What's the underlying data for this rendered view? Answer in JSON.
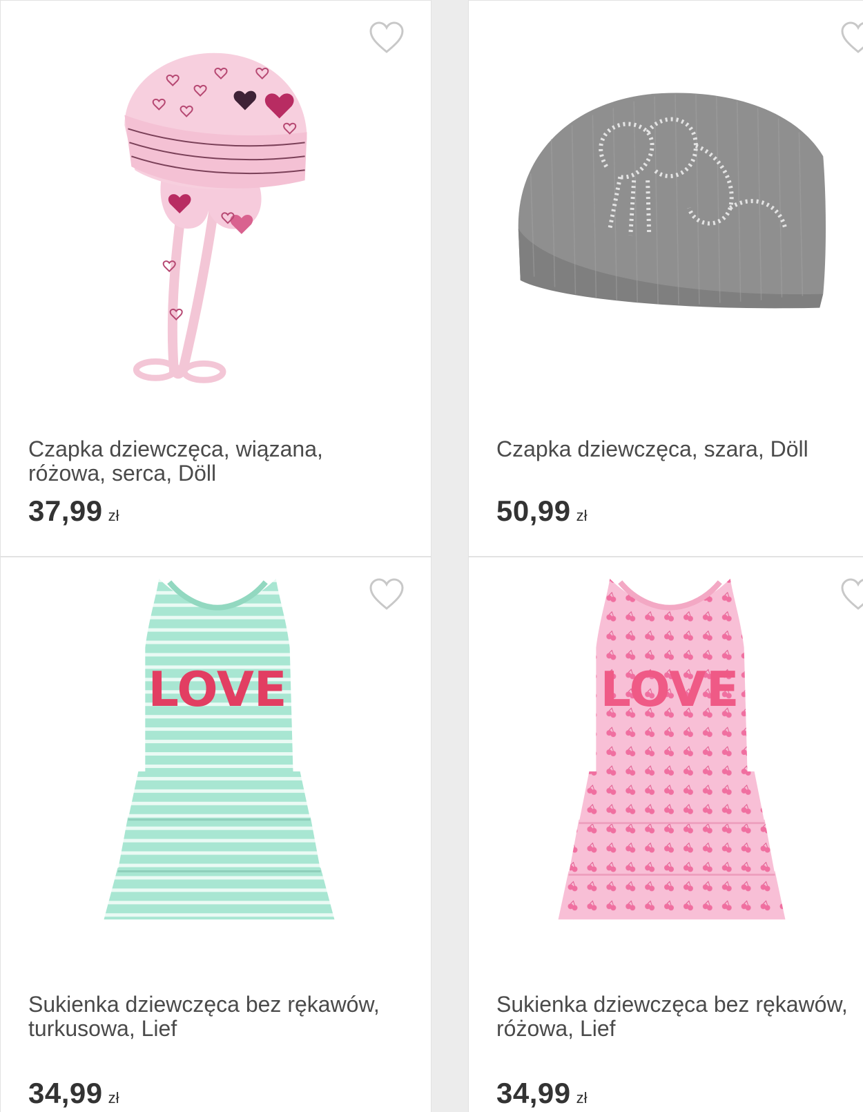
{
  "products": [
    {
      "title": "Czapka dziewczęca, wiązana, różowa, serca, Döll",
      "price": "37,99",
      "currency": "zł",
      "wishlist_icon": "heart-outline-icon",
      "image": "pink hat with hearts and ties"
    },
    {
      "title": "Czapka dziewczęca, szara, Döll",
      "price": "50,99",
      "currency": "zł",
      "wishlist_icon": "heart-outline-icon",
      "image": "grey knitted beanie with rhinestones"
    },
    {
      "title": "Sukienka dziewczęca bez rękawów, turkusowa, Lief",
      "price": "34,99",
      "currency": "zł",
      "wishlist_icon": "heart-outline-icon",
      "image": "turquoise striped tiered dress with LOVE print"
    },
    {
      "title": "Sukienka dziewczęca bez rękawów, różowa, Lief",
      "price": "34,99",
      "currency": "zł",
      "wishlist_icon": "heart-outline-icon",
      "image": "pink cherry print tiered dress with LOVE print"
    }
  ],
  "colors": {
    "card_background": "#ffffff",
    "page_background": "#ececec",
    "title_text": "#4a4a4a",
    "price_text": "#333333",
    "heart_outline": "#c8c8c8"
  }
}
